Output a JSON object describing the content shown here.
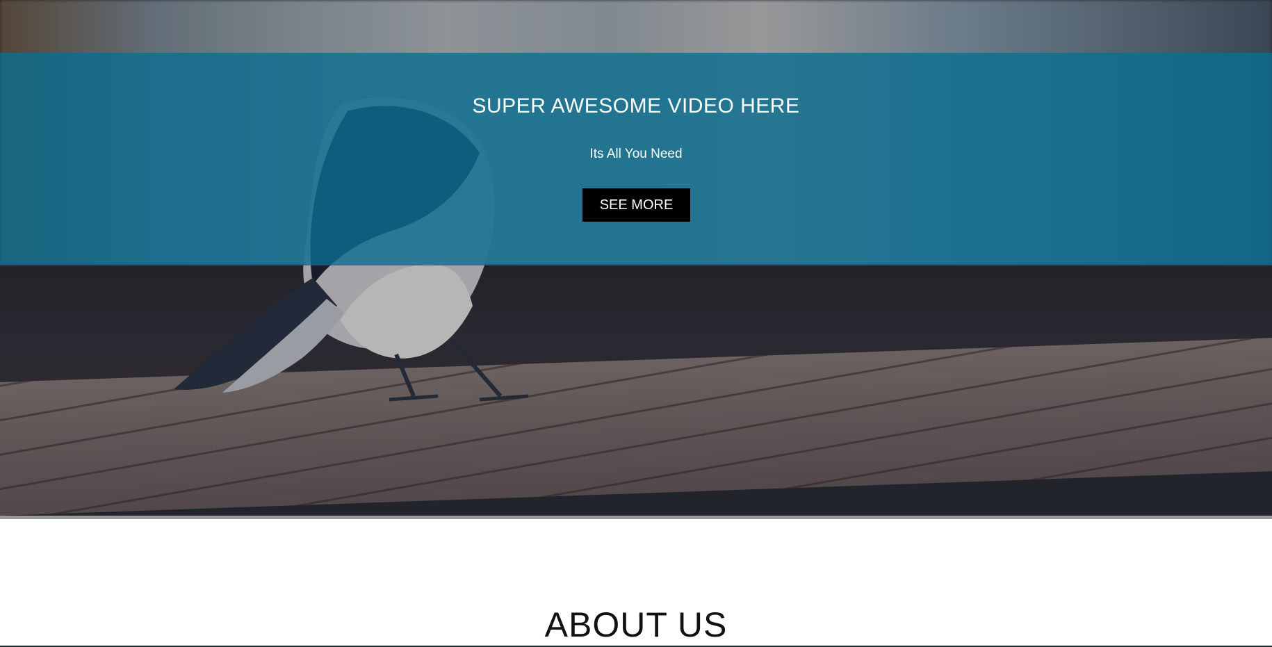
{
  "hero": {
    "title": "SUPER AWESOME VIDEO HERE",
    "subtitle": "Its All You Need",
    "button_label": "SEE MORE",
    "banner_color": "#0a6e91"
  },
  "about": {
    "title": "ABOUT US"
  },
  "colors": {
    "button_bg": "#000000",
    "text_light": "#ffffff",
    "text_dark": "#111111"
  }
}
